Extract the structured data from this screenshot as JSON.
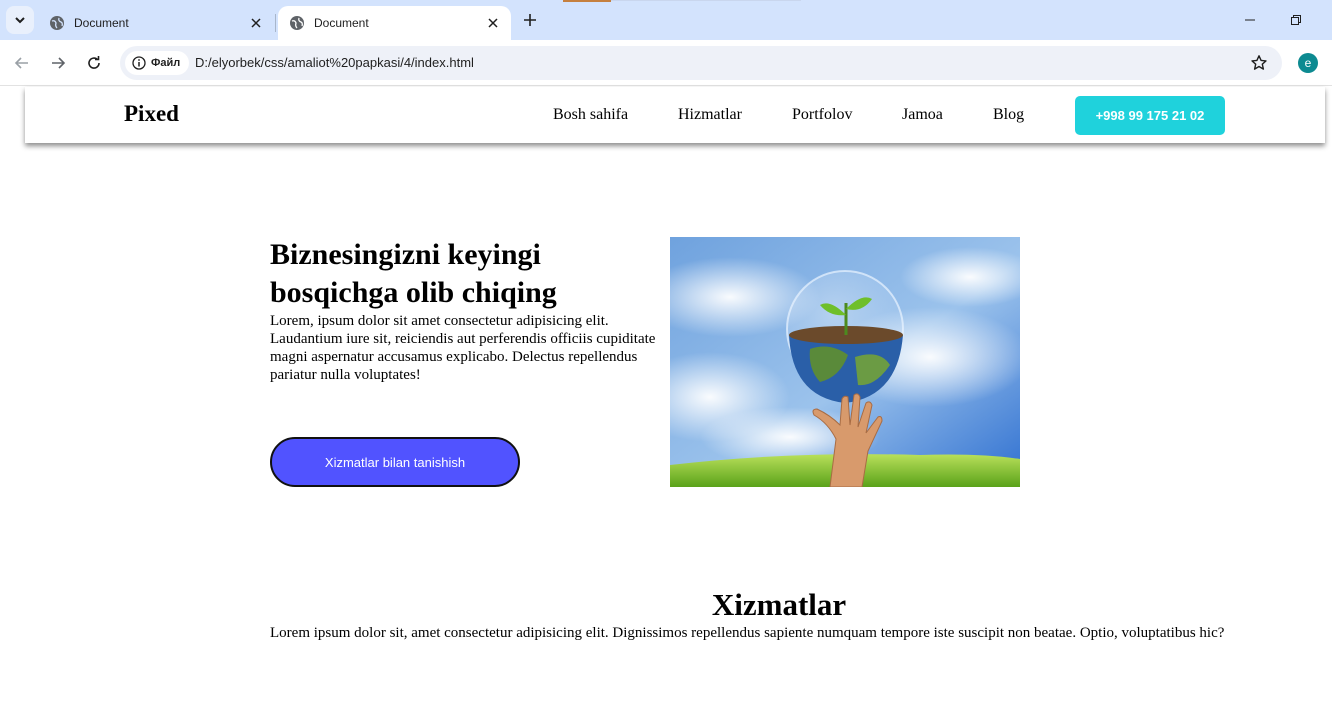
{
  "browser": {
    "tabs": [
      {
        "title": "Document",
        "active": false
      },
      {
        "title": "Document",
        "active": true
      }
    ],
    "site_chip_label": "Файл",
    "url": "D:/elyorbek/css/amaliot%20papkasi/4/index.html",
    "profile_initial": "e"
  },
  "header": {
    "logo": "Pixed",
    "menu": [
      "Bosh sahifa",
      "Hizmatlar",
      "Portfolov",
      "Jamoa",
      "Blog"
    ],
    "phone": "+998 99 175 21 02"
  },
  "hero": {
    "title": "Biznesingizni keyingi bosqichga olib chiqing",
    "text": "Lorem, ipsum dolor sit amet consectetur adipisicing elit. Laudantium iure sit, reiciendis aut perferendis officiis cupiditate magni aspernatur accusamus explicabo. Delectus repellendus pariatur nulla voluptates!",
    "button": "Xizmatlar bilan tanishish"
  },
  "services": {
    "title": "Xizmatlar",
    "text": "Lorem ipsum dolor sit, amet consectetur adipisicing elit. Dignissimos repellendus sapiente numquam tempore iste suscipit non beatae. Optio, voluptatibus hic?"
  },
  "colors": {
    "tabstrip": "#d3e3fd",
    "cta": "#5153ff",
    "phone_button": "#1fd2dc",
    "profile": "#0d8a91"
  }
}
